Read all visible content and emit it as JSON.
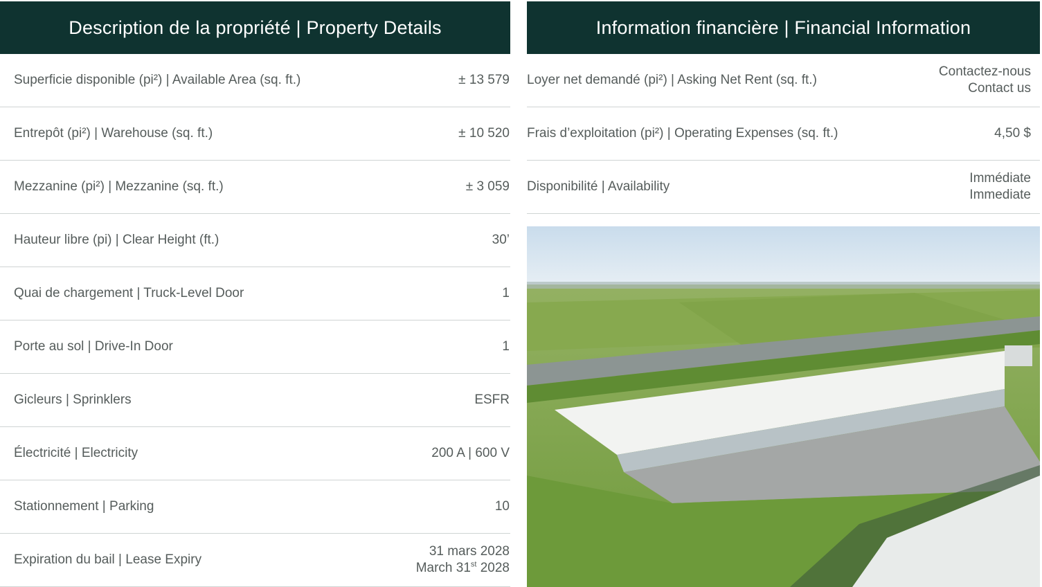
{
  "property": {
    "title": "Description de la propriété | Property Details",
    "rows": [
      {
        "label": "Superficie disponible (pi²) | Available Area (sq. ft.)",
        "value": "± 13 579"
      },
      {
        "label": "Entrepôt (pi²) | Warehouse (sq. ft.)",
        "value": "± 10 520"
      },
      {
        "label": "Mezzanine (pi²) | Mezzanine (sq. ft.)",
        "value": "± 3 059"
      },
      {
        "label": "Hauteur libre (pi) | Clear Height (ft.)",
        "value": "30’"
      },
      {
        "label": "Quai de chargement | Truck-Level Door",
        "value": "1"
      },
      {
        "label": "Porte au sol | Drive-In Door",
        "value": "1"
      },
      {
        "label": "Gicleurs | Sprinklers",
        "value": "ESFR"
      },
      {
        "label": "Électricité | Electricity",
        "value": "200 A | 600 V"
      },
      {
        "label": "Stationnement | Parking",
        "value": "10"
      },
      {
        "label": "Expiration du bail | Lease Expiry",
        "value_fr": "31 mars 2028",
        "value_en_pre": "March 31",
        "value_en_sup": "st",
        "value_en_post": " 2028"
      }
    ]
  },
  "financial": {
    "title": "Information financière | Financial Information",
    "rows": [
      {
        "label": "Loyer net demandé (pi²) | Asking Net Rent (sq. ft.)",
        "value_fr": "Contactez-nous",
        "value_en": "Contact us"
      },
      {
        "label": "Frais d’exploitation (pi²) | Operating Expenses (sq. ft.)",
        "value": "4,50 $"
      },
      {
        "label": "Disponibilité | Availability",
        "value_fr": "Immédiate",
        "value_en": "Immediate"
      }
    ]
  },
  "colors": {
    "header_bg": "#0f3330",
    "header_text": "#ffffff",
    "row_text": "#555c5b",
    "divider": "#cfd4d3"
  }
}
